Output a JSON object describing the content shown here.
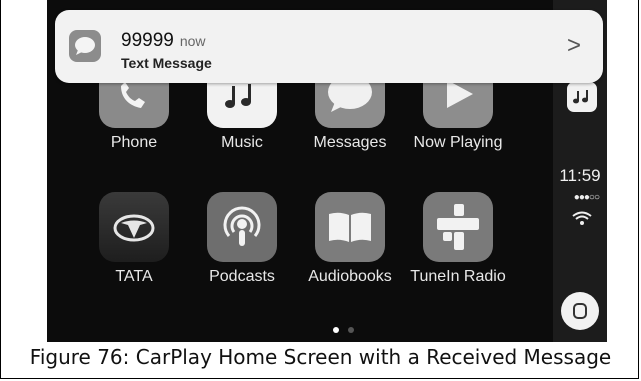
{
  "notification": {
    "sender": "99999",
    "time": "now",
    "type": "Text Message",
    "app_icon": "message-icon",
    "chevron": ">"
  },
  "apps": [
    {
      "label": "Phone",
      "icon": "phone-icon"
    },
    {
      "label": "Music",
      "icon": "music-icon"
    },
    {
      "label": "Messages",
      "icon": "messages-icon"
    },
    {
      "label": "Now Playing",
      "icon": "now-playing-icon"
    },
    {
      "label": "TATA",
      "icon": "tata-logo-icon"
    },
    {
      "label": "Podcasts",
      "icon": "podcasts-icon"
    },
    {
      "label": "Audiobooks",
      "icon": "audiobooks-icon"
    },
    {
      "label": "TuneIn Radio",
      "icon": "tunein-radio-icon"
    }
  ],
  "status": {
    "time": "11:59",
    "signal": "●●●○○"
  },
  "pagination": {
    "pages": 2,
    "current": 1
  },
  "caption": "Figure 76: CarPlay Home Screen with a Received Message",
  "colors": {
    "screen_bg": "#0c0c0c",
    "banner_bg": "#f2f2f2",
    "dot_active": "#ffffff",
    "dot_inactive": "#555555"
  }
}
